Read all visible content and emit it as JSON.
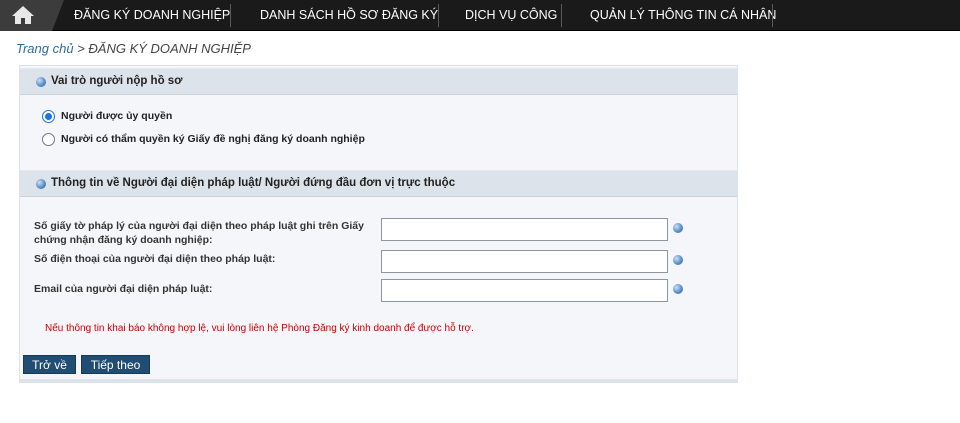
{
  "nav": {
    "home_icon": "home-icon",
    "items": [
      {
        "label": "ĐĂNG KÝ DOANH NGHIỆP"
      },
      {
        "label": "DANH SÁCH HỒ SƠ ĐĂNG KÝ"
      },
      {
        "label": "DỊCH VỤ CÔNG"
      },
      {
        "label": "QUẢN LÝ THÔNG TIN CÁ NHÂN"
      }
    ]
  },
  "breadcrumb": {
    "home": "Trang chủ",
    "separator": " > ",
    "current": "ĐĂNG KÝ DOANH NGHIỆP"
  },
  "section_role": {
    "title": "Vai trò người nộp hồ sơ",
    "options": [
      {
        "label": "Người được ủy quyền",
        "selected": true
      },
      {
        "label": "Người có thẩm quyền ký Giấy đề nghị đăng ký doanh nghiệp",
        "selected": false
      }
    ]
  },
  "section_rep": {
    "title": "Thông tin về Người đại diện pháp luật/ Người đứng đầu đơn vị trực thuộc",
    "fields": [
      {
        "label": "Số giấy tờ pháp lý của người đại diện theo pháp luật ghi trên Giấy chứng nhận đăng ký doanh nghiệp:",
        "value": ""
      },
      {
        "label": "Số điện thoại của người đại diện theo pháp luật:",
        "value": ""
      },
      {
        "label": "Email của người đại diện pháp luật:",
        "value": ""
      }
    ],
    "notice": "Nếu thông tin khai báo không hợp lệ, vui lòng liên hệ Phòng Đăng ký kinh doanh để được hỗ trợ."
  },
  "buttons": {
    "back": "Trở về",
    "next": "Tiếp theo"
  },
  "colors": {
    "nav_bg": "#1a1a1a",
    "section_header_bg": "#dce3ea",
    "button_bg": "#1f4d73",
    "notice": "#cc0000",
    "link": "#2e6da4"
  }
}
